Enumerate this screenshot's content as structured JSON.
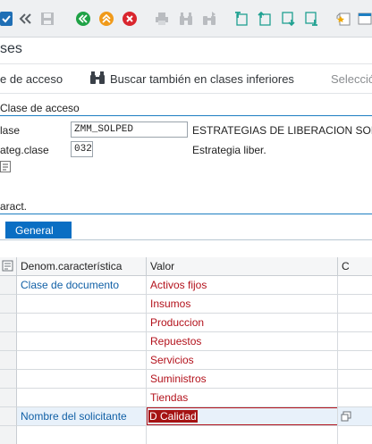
{
  "toolbar": {
    "icons": [
      "enter-icon",
      "back-double-icon",
      "save-icon",
      "back-icon",
      "exit-icon",
      "cancel-icon",
      "print-icon",
      "find-icon",
      "find-next-icon",
      "first-page-icon",
      "previous-page-icon",
      "next-page-icon",
      "last-page-icon",
      "create-session-icon"
    ]
  },
  "title": "ses",
  "app_toolbar": {
    "access_class_label": "e de acceso",
    "search_sub_label": "Buscar también en clases inferiores",
    "selection_label": "Selecció"
  },
  "access_section": {
    "title": "Clase de acceso",
    "class_label": "lase",
    "class_value": "ZMM_SOLPED",
    "class_desc": "ESTRATEGIAS DE LIBERACION SOLP",
    "category_label": "ateg.clase",
    "category_value": "032",
    "category_desc": "Estrategia liber."
  },
  "characteristics": {
    "title": "aract.",
    "tab_label": "General",
    "headers": {
      "charname": "Denom.característica",
      "value": "Valor",
      "c": "C"
    },
    "rows": [
      {
        "charname": "Clase de documento",
        "value": "Activos fijos"
      },
      {
        "charname": "",
        "value": "Insumos"
      },
      {
        "charname": "",
        "value": "Produccion"
      },
      {
        "charname": "",
        "value": "Repuestos"
      },
      {
        "charname": "",
        "value": "Servicios"
      },
      {
        "charname": "",
        "value": "Suministros"
      },
      {
        "charname": "",
        "value": "Tiendas"
      },
      {
        "charname": "Nombre del solicitante",
        "value": "D Calidad"
      }
    ]
  },
  "colors": {
    "accent": "#1d7ec2",
    "tab": "#0a6ec3",
    "value_text": "#b3121c",
    "char_text": "#1160a6"
  }
}
